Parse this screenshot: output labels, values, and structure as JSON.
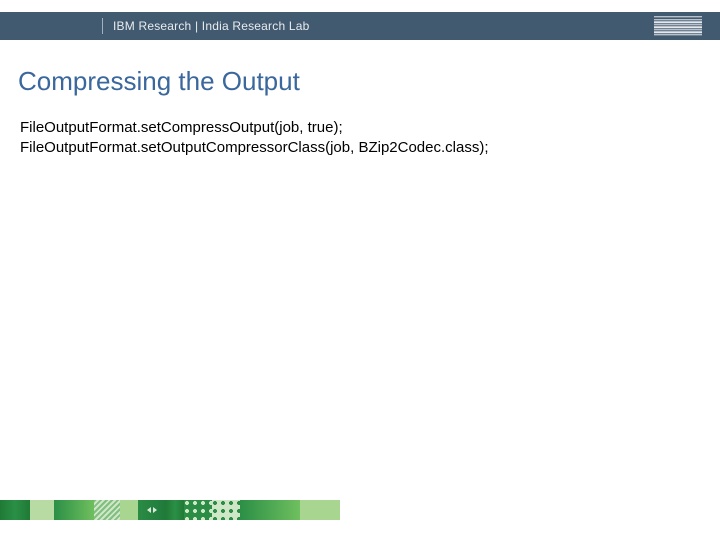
{
  "header": {
    "text": "IBM Research  |  India Research Lab"
  },
  "title": "Compressing the Output",
  "code": {
    "line1": "FileOutputFormat.setCompressOutput(job, true);",
    "line2": "FileOutputFormat.setOutputCompressorClass(job, BZip2Codec.class);"
  }
}
